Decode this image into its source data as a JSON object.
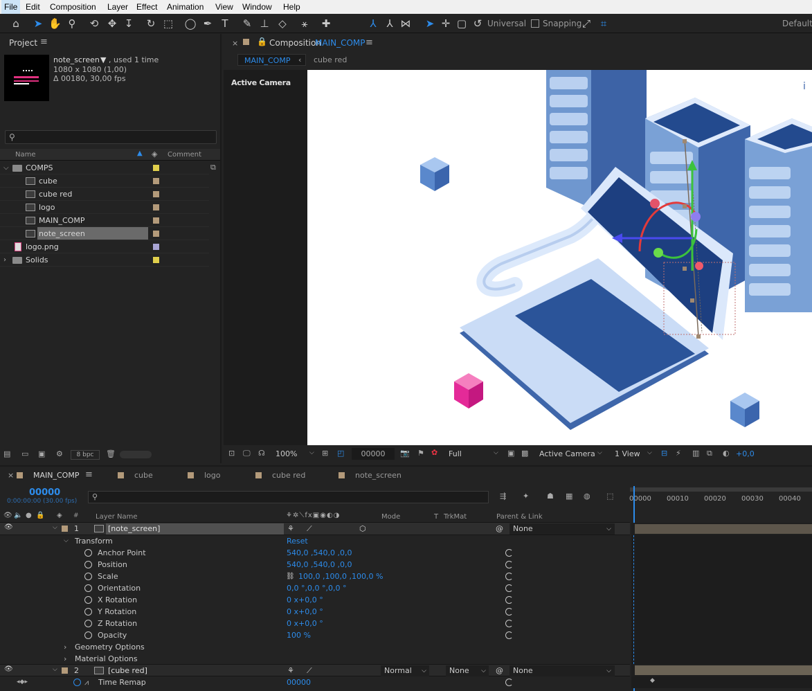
{
  "menu": [
    "File",
    "Edit",
    "Composition",
    "Layer",
    "Effect",
    "Animation",
    "View",
    "Window",
    "Help"
  ],
  "toolbar": {
    "universal": "Universal",
    "snapping": "Snapping",
    "workspace": "Default"
  },
  "project": {
    "title": "Project",
    "item_name": "note_screen",
    "item_used": ", used 1 time",
    "item_dims": "1080 x 1080 (1,00)",
    "item_duration": "Δ 00180, 30,00 fps",
    "search_placeholder": "",
    "col_name": "Name",
    "col_comment": "Comment",
    "bpc": "8 bpc",
    "items": [
      {
        "label": "COMPS",
        "type": "folder",
        "color": "#e0cf4c",
        "indent": 0
      },
      {
        "label": "cube",
        "type": "comp",
        "color": "#b39a7a",
        "indent": 1
      },
      {
        "label": "cube red",
        "type": "comp",
        "color": "#b39a7a",
        "indent": 1
      },
      {
        "label": "logo",
        "type": "comp",
        "color": "#b39a7a",
        "indent": 1
      },
      {
        "label": "MAIN_COMP",
        "type": "comp",
        "color": "#b39a7a",
        "indent": 1
      },
      {
        "label": "note_screen",
        "type": "comp",
        "color": "#b39a7a",
        "indent": 1,
        "selected": true
      },
      {
        "label": "logo.png",
        "type": "file",
        "color": "#a8a4d4",
        "indent": 0
      },
      {
        "label": "Solids",
        "type": "folder",
        "color": "#e0cf4c",
        "indent": 0
      }
    ]
  },
  "composition": {
    "title_prefix": "Composition",
    "title_name": "MAIN_COMP",
    "tab_active": "MAIN_COMP",
    "tab_other": "cube red",
    "camera_label": "Active Camera"
  },
  "viewer_bar": {
    "zoom": "100%",
    "timecode": "00000",
    "resolution": "Full",
    "camera": "Active Camera",
    "views": "1 View",
    "exposure": "+0,0"
  },
  "timeline": {
    "tabs": [
      "MAIN_COMP",
      "cube",
      "logo",
      "cube red",
      "note_screen"
    ],
    "timecode": "00000",
    "timecode_sub": "0:00:00:00 (30.00 fps)",
    "ruler": [
      "00000",
      "00010",
      "00020",
      "00030",
      "00040"
    ],
    "headers": {
      "layer_name": "Layer Name",
      "mode": "Mode",
      "t": "T",
      "trkmat": "TrkMat",
      "parent": "Parent & Link"
    },
    "layer1": {
      "num": "1",
      "name": "[note_screen]",
      "parent": "None"
    },
    "transform": "Transform",
    "reset": "Reset",
    "props": [
      {
        "name": "Anchor Point",
        "value": "540,0 ,540,0 ,0,0"
      },
      {
        "name": "Position",
        "value": "540,0 ,540,0 ,0,0"
      },
      {
        "name": "Scale",
        "value": "100,0 ,100,0 ,100,0 %"
      },
      {
        "name": "Orientation",
        "value": "0,0 °,0,0 °,0,0 °"
      },
      {
        "name": "X Rotation",
        "value": "0 x+0,0 °"
      },
      {
        "name": "Y Rotation",
        "value": "0 x+0,0 °"
      },
      {
        "name": "Z Rotation",
        "value": "0 x+0,0 °"
      },
      {
        "name": "Opacity",
        "value": "100 %"
      }
    ],
    "geometry": "Geometry Options",
    "material": "Material Options",
    "layer2": {
      "num": "2",
      "name": "[cube red]",
      "mode": "Normal",
      "trkmat": "None",
      "parent": "None"
    },
    "time_remap": {
      "name": "Time Remap",
      "value": "00000"
    }
  },
  "colors": {
    "accent": "#2d8ceb",
    "bg": "#232323",
    "menubar": "#f0f0f0"
  }
}
